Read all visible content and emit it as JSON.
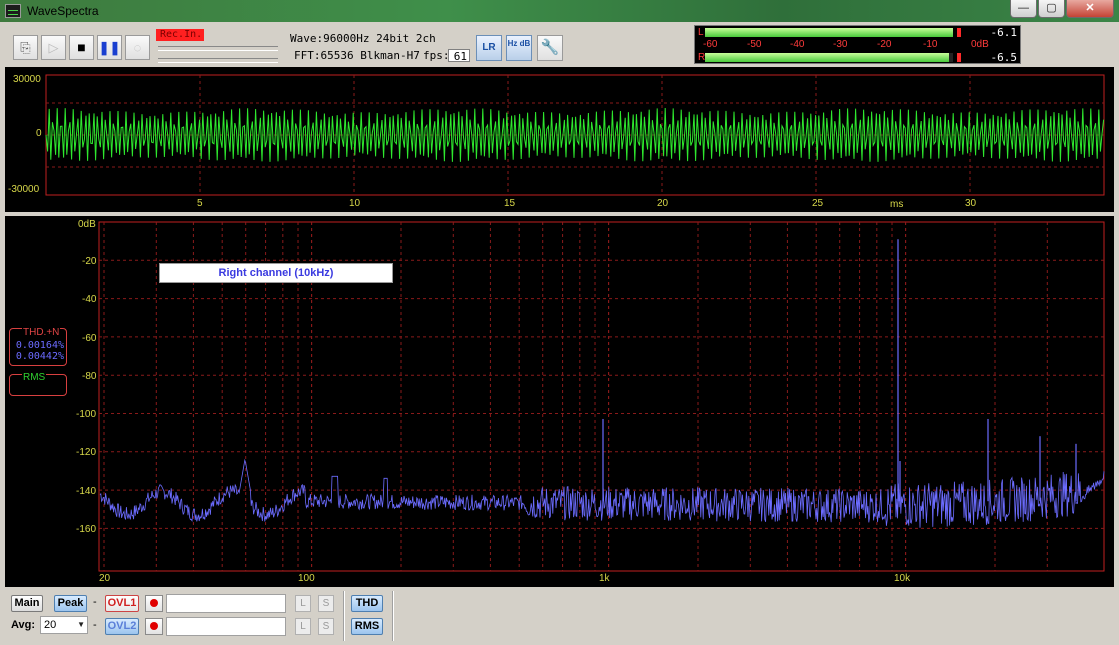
{
  "window": {
    "title": "WaveSpectra",
    "minimize": "—",
    "maximize": "▢",
    "close": "✕"
  },
  "toolbar": {
    "rec_in": "Rec.In.",
    "wave_info": "Wave:96000Hz 24bit 2ch",
    "fft_info": "FFT:65536 Blkman-H7",
    "fps_label": "fps:",
    "fps_value": "61",
    "lr_label": "LR",
    "hz_db_label": "Hz dB"
  },
  "meters": {
    "left_label": "L",
    "right_label": "R",
    "left_value": "-6.1",
    "right_value": "-6.5",
    "scale": [
      "-60",
      "-50",
      "-40",
      "-30",
      "-20",
      "-10",
      "0dB"
    ]
  },
  "waveform": {
    "y_ticks": [
      "30000",
      "0",
      "-30000"
    ],
    "x_ticks": [
      "5",
      "10",
      "15",
      "20",
      "25",
      "30"
    ],
    "x_unit": "ms",
    "color": "#2ee82e"
  },
  "spectrum": {
    "y_ticks": [
      "0dB",
      "-20",
      "-40",
      "-60",
      "-80",
      "-100",
      "-120",
      "-140",
      "-160"
    ],
    "x_ticks": [
      "20",
      "100",
      "1k",
      "10k"
    ],
    "channel_label": "Right channel (10kHz)",
    "color": "#6c6cff",
    "thd_title": "THD.+N",
    "thd_value1": "0.00164%",
    "thd_value2": "0.00442%",
    "rms_title": "RMS"
  },
  "bottom": {
    "main": "Main",
    "peak": "Peak",
    "dash": "-",
    "ovl1": "OVL1",
    "ovl2": "OVL2",
    "l": "L",
    "s": "S",
    "avg_label": "Avg:",
    "avg_value": "20",
    "thd": "THD",
    "rms": "RMS"
  },
  "colors": {
    "grid": "#8a1a1a",
    "frame": "#c02020",
    "axis_text": "#d8d84a"
  }
}
